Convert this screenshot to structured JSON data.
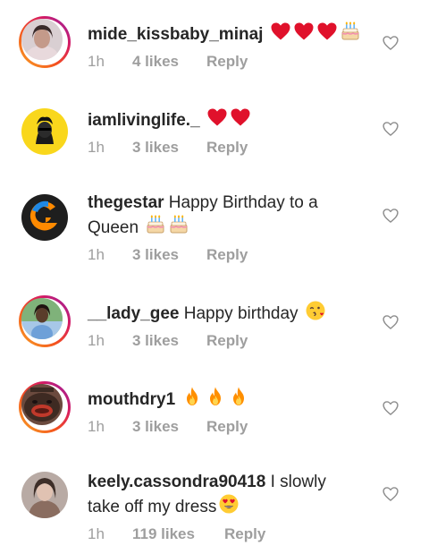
{
  "comments": [
    {
      "username": "mide_kissbaby_minaj",
      "text": "",
      "emojis": [
        "red-heart",
        "red-heart",
        "red-heart",
        "birthday-cake"
      ],
      "time": "1h",
      "likes": "4 likes",
      "reply": "Reply"
    },
    {
      "username": "iamlivinglife._",
      "text": "",
      "emojis": [
        "red-heart",
        "red-heart"
      ],
      "time": "1h",
      "likes": "3 likes",
      "reply": "Reply"
    },
    {
      "username": "thegestar",
      "text": " Happy Birthday to a",
      "text_line2": "Queen",
      "emojis": [
        "birthday-cake",
        "birthday-cake"
      ],
      "time": "1h",
      "likes": "3 likes",
      "reply": "Reply"
    },
    {
      "username": "__lady_gee",
      "text": " Happy birthday",
      "emojis": [
        "face-blowing-kiss"
      ],
      "time": "1h",
      "likes": "3 likes",
      "reply": "Reply"
    },
    {
      "username": "mouthdry1",
      "text": "",
      "emojis": [
        "fire",
        "fire",
        "fire"
      ],
      "time": "1h",
      "likes": "3 likes",
      "reply": "Reply"
    },
    {
      "username": "keely.cassondra90418",
      "text": " I slowly",
      "text_line2": "take off my dress",
      "emojis": [
        "heart-eyes-face"
      ],
      "time": "1h",
      "likes": "119 likes",
      "reply": "Reply"
    }
  ],
  "colors": {
    "text": "#262626",
    "meta": "#9e9e9e",
    "heart_red": "#e0112b",
    "story_ring": "#d81b60"
  },
  "icons": {
    "like": "heart-outline-icon"
  }
}
